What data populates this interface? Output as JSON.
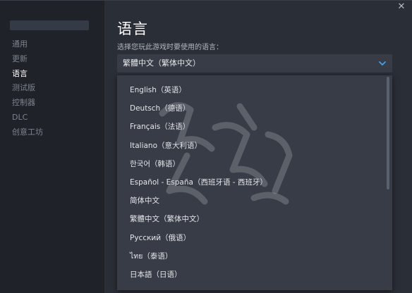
{
  "window": {
    "close_glyph": "✕"
  },
  "sidebar": {
    "items": [
      {
        "label": "通用",
        "active": false
      },
      {
        "label": "更新",
        "active": false
      },
      {
        "label": "语言",
        "active": true
      },
      {
        "label": "测试版",
        "active": false
      },
      {
        "label": "控制器",
        "active": false
      },
      {
        "label": "DLC",
        "active": false
      },
      {
        "label": "创意工坊",
        "active": false
      }
    ]
  },
  "main": {
    "title": "语言",
    "prompt": "选择您玩此游戏时要使用的语言：",
    "selected_value": "繁體中文（繁体中文）",
    "chevron_icon": "chevron-down-icon",
    "accent_color": "#4c9ee8"
  },
  "dropdown": {
    "options": [
      "English（英语）",
      "Deutsch（德语）",
      "Français（法语）",
      "Italiano（意大利语）",
      "한국어（韩语）",
      "Español - España（西班牙语 - 西班牙）",
      "简体中文",
      "繁體中文（繁体中文）",
      "Русский（俄语）",
      "ไทย（泰语）",
      "日本語（日语）"
    ]
  }
}
